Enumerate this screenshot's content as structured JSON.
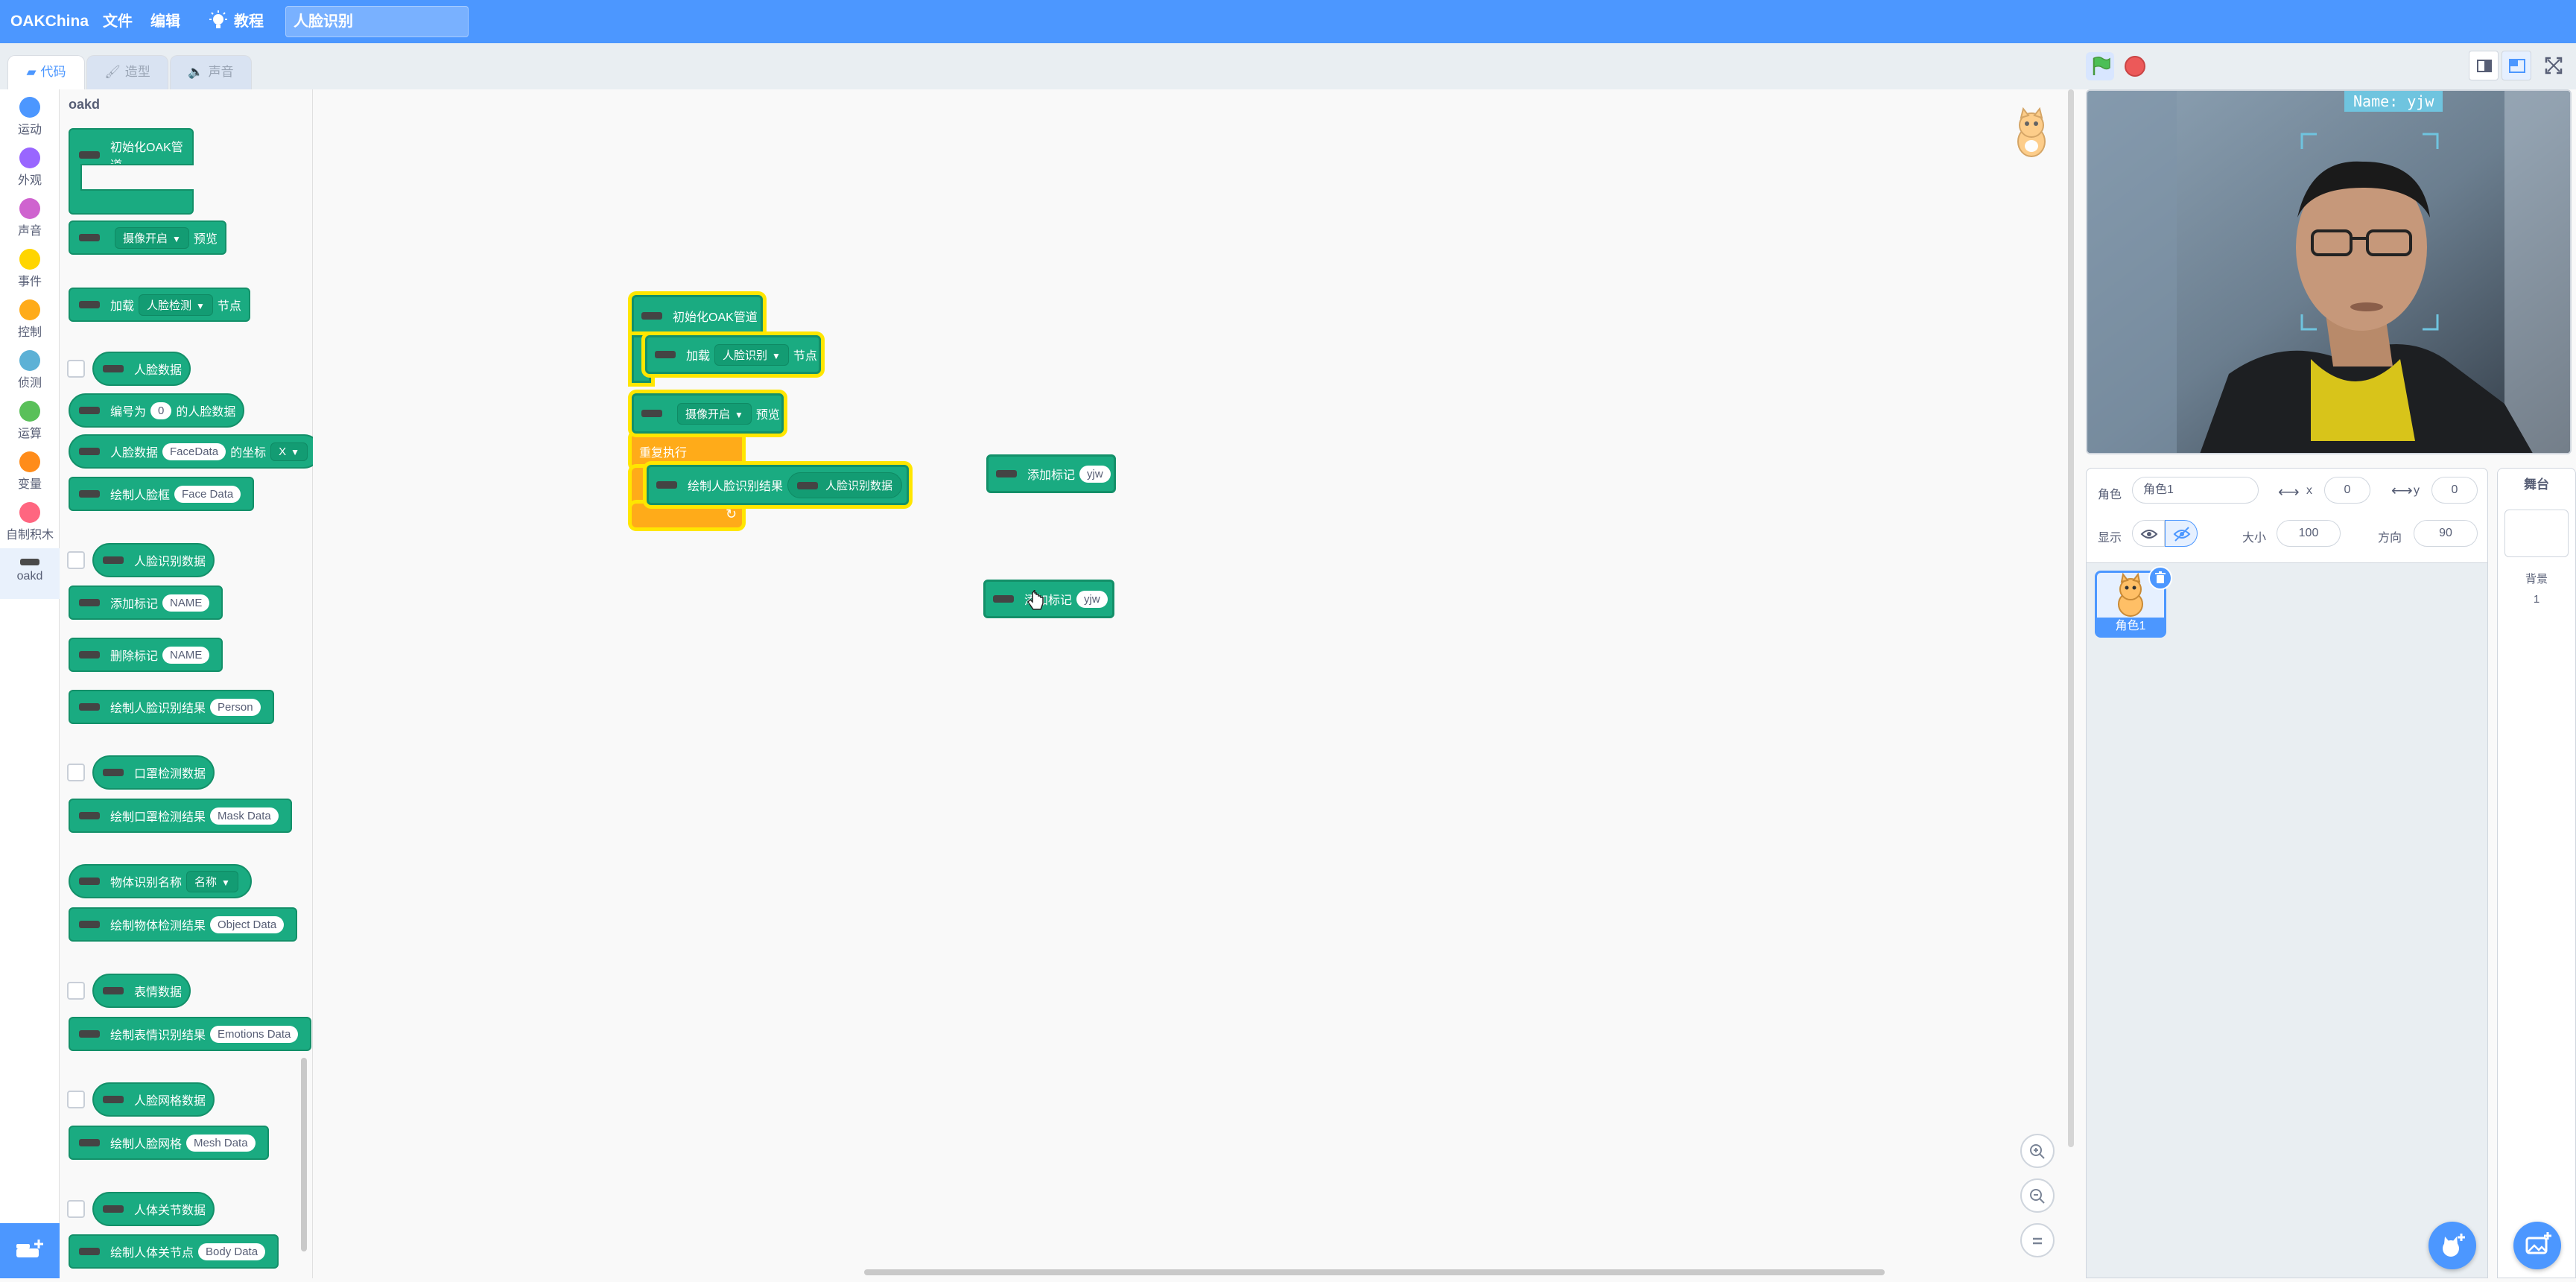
{
  "menubar": {
    "logo": "OAKChina",
    "file": "文件",
    "edit": "编辑",
    "tutorials": "教程",
    "project_title": "人脸识别"
  },
  "tabs": {
    "code": "代码",
    "costumes": "造型",
    "sounds": "声音"
  },
  "categories": [
    {
      "label": "运动",
      "color": "#4c97ff"
    },
    {
      "label": "外观",
      "color": "#9966ff"
    },
    {
      "label": "声音",
      "color": "#cf63cf"
    },
    {
      "label": "事件",
      "color": "#ffd500"
    },
    {
      "label": "控制",
      "color": "#ffab19"
    },
    {
      "label": "侦测",
      "color": "#5cb1d6"
    },
    {
      "label": "运算",
      "color": "#59c059"
    },
    {
      "label": "变量",
      "color": "#ff8c1a"
    },
    {
      "label": "自制积木",
      "color": "#ff6680"
    },
    {
      "label": "oakd",
      "color": "#4a4a4a"
    }
  ],
  "palette": {
    "heading": "oakd",
    "init_pipeline": "初始化OAK管道",
    "camera_on": "摄像开启",
    "preview": "预览",
    "load": "加载",
    "face_detect": "人脸检测",
    "node": "节点",
    "face_data": "人脸数据",
    "numbered": "编号为",
    "zero": "0",
    "of_face_data": "的人脸数据",
    "facedata": "FaceData",
    "coords_of": "的坐标",
    "x": "X",
    "draw_face_box": "绘制人脸框",
    "face_data_value": "Face Data",
    "face_recog_data": "人脸识别数据",
    "add_tag": "添加标记",
    "name_placeholder": "NAME",
    "delete_tag": "删除标记",
    "draw_face_recog": "绘制人脸识别结果",
    "person": "Person",
    "mask_data": "口罩检测数据",
    "draw_mask": "绘制口罩检测结果",
    "mask_data_value": "Mask Data",
    "object_name": "物体识别名称",
    "name_dd": "名称",
    "draw_object": "绘制物体检测结果",
    "object_data": "Object Data",
    "emotion_data": "表情数据",
    "draw_emotion": "绘制表情识别结果",
    "emotions_data": "Emotions Data",
    "mesh_data": "人脸网格数据",
    "draw_mesh": "绘制人脸网格",
    "mesh_data_value": "Mesh Data",
    "body_data": "人体关节数据",
    "draw_body": "绘制人体关节点",
    "body_data_value": "Body Data"
  },
  "script": {
    "init_pipeline": "初始化OAK管道",
    "load": "加载",
    "face_recog": "人脸识别",
    "node": "节点",
    "camera_on": "摄像开启",
    "preview": "预览",
    "forever": "重复执行",
    "draw_result": "绘制人脸识别结果",
    "face_recog_data": "人脸识别数据",
    "add_tag": "添加标记",
    "tag_value": "yjw",
    "dragged_label": "添加标记",
    "dragged_value": "yjw"
  },
  "stage": {
    "name_overlay": "Name: yjw"
  },
  "sprite_info": {
    "sprite_label": "角色",
    "sprite_name": "角色1",
    "x_label": "x",
    "x_value": "0",
    "y_label": "y",
    "y_value": "0",
    "show_label": "显示",
    "size_label": "大小",
    "size_value": "100",
    "direction_label": "方向",
    "direction_value": "90"
  },
  "sprite_list": [
    {
      "name": "角色1"
    }
  ],
  "stage_panel": {
    "title": "舞台",
    "backdrop_label": "背景",
    "backdrop_count": "1"
  }
}
